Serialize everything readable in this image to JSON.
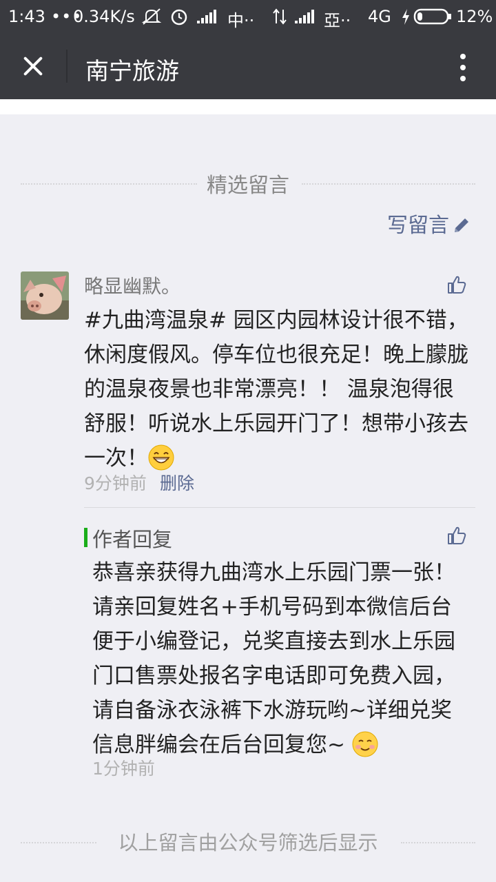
{
  "status_bar": {
    "time": "1:43",
    "net_speed": "0.34K/s",
    "carrier1": "中··",
    "carrier2": "亞··",
    "network": "4G",
    "battery": "12%"
  },
  "header": {
    "title": "南宁旅游"
  },
  "section": {
    "title": "精选留言",
    "write_label": "写留言"
  },
  "comment": {
    "nickname": "略显幽默。",
    "text": "#九曲湾温泉# 园区内园林设计很不错，休闲度假风。停车位也很充足！晚上朦胧的温泉夜景也非常漂亮！！ 温泉泡得很舒服！听说水上乐园开门了！想带小孩去一次！",
    "time": "9分钟前",
    "delete_label": "删除",
    "emoji": "grinning-emoji"
  },
  "reply": {
    "label": "作者回复",
    "text": "恭喜亲获得九曲湾水上乐园门票一张！请亲回复姓名+手机号码到本微信后台便于小编登记，兑奖直接去到水上乐园门口售票处报名字电话即可免费入园，请自备泳衣泳裤下水游玩哟~详细兑奖信息胖编会在后台回复您~ ",
    "time": "1分钟前",
    "emoji": "smiling-emoji"
  },
  "footer": {
    "text": "以上留言由公众号筛选后显示"
  },
  "colors": {
    "bar": "#393a3f",
    "background": "#efeff4",
    "link": "#5b6a92",
    "reply_accent": "#1aad19"
  }
}
